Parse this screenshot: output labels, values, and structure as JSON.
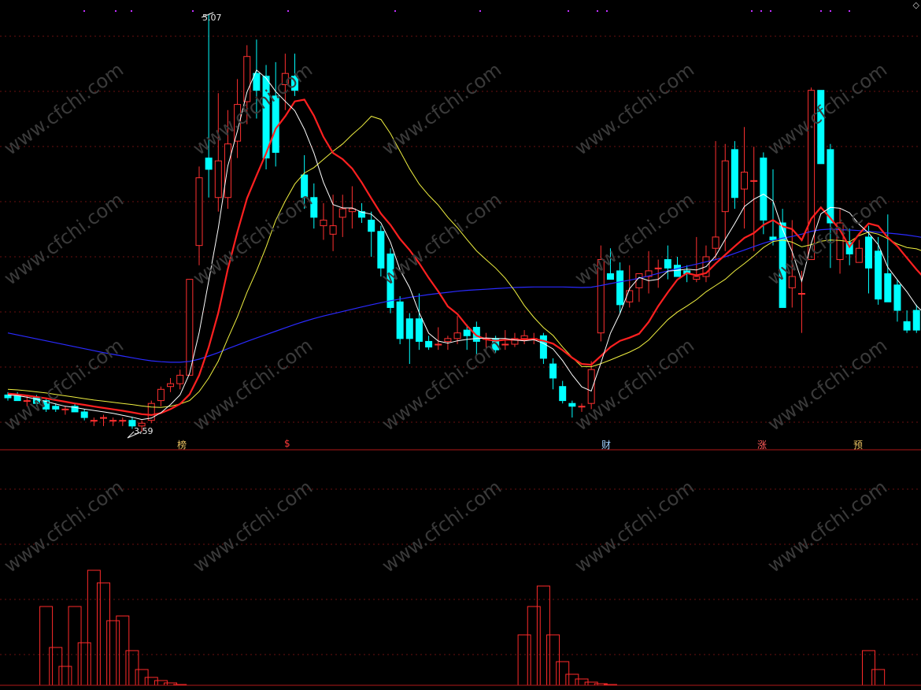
{
  "chart_data": [
    {
      "type": "candlestick",
      "annotations": {
        "high_label": "5.07",
        "low_label": "3.59"
      },
      "event_flags": [
        "榜",
        "$",
        "财",
        "涨",
        "预"
      ],
      "colors": {
        "up": "#ff3030",
        "down": "#00ffff",
        "ma5": "#ffffff",
        "ma10": "#ff2020",
        "ma20": "#f0f040",
        "ma60": "#2a2aff"
      },
      "grid": true,
      "watermark": "www.cfchi.com",
      "corner_mark": "◇",
      "candles": [
        {
          "o": 3.72,
          "h": 3.73,
          "l": 3.7,
          "c": 3.71
        },
        {
          "o": 3.72,
          "h": 3.73,
          "l": 3.7,
          "c": 3.7
        },
        {
          "o": 3.7,
          "h": 3.72,
          "l": 3.68,
          "c": 3.7
        },
        {
          "o": 3.71,
          "h": 3.72,
          "l": 3.68,
          "c": 3.69
        },
        {
          "o": 3.7,
          "h": 3.71,
          "l": 3.66,
          "c": 3.67
        },
        {
          "o": 3.68,
          "h": 3.69,
          "l": 3.66,
          "c": 3.67
        },
        {
          "o": 3.67,
          "h": 3.68,
          "l": 3.65,
          "c": 3.67
        },
        {
          "o": 3.68,
          "h": 3.69,
          "l": 3.66,
          "c": 3.66
        },
        {
          "o": 3.66,
          "h": 3.67,
          "l": 3.63,
          "c": 3.64
        },
        {
          "o": 3.63,
          "h": 3.64,
          "l": 3.61,
          "c": 3.63
        },
        {
          "o": 3.64,
          "h": 3.65,
          "l": 3.61,
          "c": 3.64
        },
        {
          "o": 3.63,
          "h": 3.64,
          "l": 3.61,
          "c": 3.63
        },
        {
          "o": 3.63,
          "h": 3.64,
          "l": 3.61,
          "c": 3.63
        },
        {
          "o": 3.63,
          "h": 3.64,
          "l": 3.6,
          "c": 3.61
        },
        {
          "o": 3.61,
          "h": 3.63,
          "l": 3.59,
          "c": 3.62
        },
        {
          "o": 3.63,
          "h": 3.7,
          "l": 3.62,
          "c": 3.69
        },
        {
          "o": 3.7,
          "h": 3.75,
          "l": 3.68,
          "c": 3.74
        },
        {
          "o": 3.75,
          "h": 3.78,
          "l": 3.73,
          "c": 3.76
        },
        {
          "o": 3.76,
          "h": 3.81,
          "l": 3.74,
          "c": 3.79
        },
        {
          "o": 3.79,
          "h": 4.13,
          "l": 3.79,
          "c": 4.13
        },
        {
          "o": 4.25,
          "h": 4.53,
          "l": 4.18,
          "c": 4.49
        },
        {
          "o": 4.56,
          "h": 5.07,
          "l": 4.42,
          "c": 4.52
        },
        {
          "o": 4.42,
          "h": 4.79,
          "l": 4.37,
          "c": 4.55
        },
        {
          "o": 4.42,
          "h": 4.73,
          "l": 4.38,
          "c": 4.61
        },
        {
          "o": 4.62,
          "h": 4.84,
          "l": 4.56,
          "c": 4.75
        },
        {
          "o": 4.76,
          "h": 4.96,
          "l": 4.68,
          "c": 4.92
        },
        {
          "o": 4.86,
          "h": 4.98,
          "l": 4.7,
          "c": 4.8
        },
        {
          "o": 4.85,
          "h": 4.89,
          "l": 4.52,
          "c": 4.56
        },
        {
          "o": 4.78,
          "h": 4.9,
          "l": 4.53,
          "c": 4.58
        },
        {
          "o": 4.82,
          "h": 4.93,
          "l": 4.73,
          "c": 4.86
        },
        {
          "o": 4.85,
          "h": 4.93,
          "l": 4.78,
          "c": 4.8
        },
        {
          "o": 4.5,
          "h": 4.57,
          "l": 4.38,
          "c": 4.42
        },
        {
          "o": 4.42,
          "h": 4.47,
          "l": 4.31,
          "c": 4.35
        },
        {
          "o": 4.32,
          "h": 4.4,
          "l": 4.27,
          "c": 4.34
        },
        {
          "o": 4.29,
          "h": 4.43,
          "l": 4.23,
          "c": 4.32
        },
        {
          "o": 4.35,
          "h": 4.43,
          "l": 4.28,
          "c": 4.38
        },
        {
          "o": 4.37,
          "h": 4.46,
          "l": 4.31,
          "c": 4.38
        },
        {
          "o": 4.37,
          "h": 4.4,
          "l": 4.33,
          "c": 4.35
        },
        {
          "o": 4.34,
          "h": 4.37,
          "l": 4.21,
          "c": 4.3
        },
        {
          "o": 4.3,
          "h": 4.32,
          "l": 4.14,
          "c": 4.17
        },
        {
          "o": 4.22,
          "h": 4.24,
          "l": 4.01,
          "c": 4.03
        },
        {
          "o": 4.05,
          "h": 4.07,
          "l": 3.9,
          "c": 3.92
        },
        {
          "o": 3.99,
          "h": 4.01,
          "l": 3.83,
          "c": 3.92
        },
        {
          "o": 3.99,
          "h": 4.08,
          "l": 3.88,
          "c": 3.91
        },
        {
          "o": 3.91,
          "h": 3.93,
          "l": 3.88,
          "c": 3.89
        },
        {
          "o": 3.9,
          "h": 3.96,
          "l": 3.88,
          "c": 3.9
        },
        {
          "o": 3.91,
          "h": 3.93,
          "l": 3.88,
          "c": 3.92
        },
        {
          "o": 3.92,
          "h": 4.0,
          "l": 3.9,
          "c": 3.94
        },
        {
          "o": 3.95,
          "h": 3.97,
          "l": 3.88,
          "c": 3.93
        },
        {
          "o": 3.96,
          "h": 3.98,
          "l": 3.86,
          "c": 3.91
        },
        {
          "o": 3.92,
          "h": 3.94,
          "l": 3.88,
          "c": 3.92
        },
        {
          "o": 3.92,
          "h": 3.93,
          "l": 3.87,
          "c": 3.88
        },
        {
          "o": 3.9,
          "h": 3.95,
          "l": 3.88,
          "c": 3.9
        },
        {
          "o": 3.9,
          "h": 3.94,
          "l": 3.89,
          "c": 3.92
        },
        {
          "o": 3.92,
          "h": 3.95,
          "l": 3.9,
          "c": 3.93
        },
        {
          "o": 3.92,
          "h": 3.94,
          "l": 3.9,
          "c": 3.92
        },
        {
          "o": 3.93,
          "h": 3.94,
          "l": 3.83,
          "c": 3.85
        },
        {
          "o": 3.83,
          "h": 3.85,
          "l": 3.74,
          "c": 3.78
        },
        {
          "o": 3.75,
          "h": 3.77,
          "l": 3.69,
          "c": 3.7
        },
        {
          "o": 3.69,
          "h": 3.7,
          "l": 3.64,
          "c": 3.68
        },
        {
          "o": 3.68,
          "h": 3.69,
          "l": 3.66,
          "c": 3.68
        },
        {
          "o": 3.69,
          "h": 3.84,
          "l": 3.67,
          "c": 3.81
        },
        {
          "o": 3.94,
          "h": 4.25,
          "l": 3.91,
          "c": 4.2
        },
        {
          "o": 4.15,
          "h": 4.24,
          "l": 4.14,
          "c": 4.13
        },
        {
          "o": 4.16,
          "h": 4.19,
          "l": 4.01,
          "c": 4.04
        },
        {
          "o": 4.05,
          "h": 4.18,
          "l": 4.03,
          "c": 4.09
        },
        {
          "o": 4.1,
          "h": 4.15,
          "l": 4.05,
          "c": 4.15
        },
        {
          "o": 4.14,
          "h": 4.23,
          "l": 4.08,
          "c": 4.16
        },
        {
          "o": 4.17,
          "h": 4.2,
          "l": 4.1,
          "c": 4.17
        },
        {
          "o": 4.2,
          "h": 4.25,
          "l": 4.13,
          "c": 4.17
        },
        {
          "o": 4.18,
          "h": 4.21,
          "l": 4.14,
          "c": 4.14
        },
        {
          "o": 4.16,
          "h": 4.18,
          "l": 4.12,
          "c": 4.15
        },
        {
          "o": 4.13,
          "h": 4.28,
          "l": 4.12,
          "c": 4.14
        },
        {
          "o": 4.14,
          "h": 4.25,
          "l": 4.12,
          "c": 4.21
        },
        {
          "o": 4.24,
          "h": 4.62,
          "l": 4.2,
          "c": 4.28
        },
        {
          "o": 4.37,
          "h": 4.61,
          "l": 4.23,
          "c": 4.55
        },
        {
          "o": 4.59,
          "h": 4.62,
          "l": 4.38,
          "c": 4.42
        },
        {
          "o": 4.45,
          "h": 4.67,
          "l": 4.31,
          "c": 4.51
        },
        {
          "o": 4.48,
          "h": 4.6,
          "l": 4.23,
          "c": 4.48
        },
        {
          "o": 4.56,
          "h": 4.58,
          "l": 4.29,
          "c": 4.34
        },
        {
          "o": 4.28,
          "h": 4.52,
          "l": 4.25,
          "c": 4.27
        },
        {
          "o": 4.33,
          "h": 4.38,
          "l": 4.04,
          "c": 4.03
        },
        {
          "o": 4.1,
          "h": 4.34,
          "l": 4.03,
          "c": 4.14
        },
        {
          "o": 4.08,
          "h": 4.16,
          "l": 3.94,
          "c": 4.08
        },
        {
          "o": 4.2,
          "h": 4.81,
          "l": 4.2,
          "c": 4.8
        },
        {
          "o": 4.8,
          "h": 4.8,
          "l": 4.54,
          "c": 4.54
        },
        {
          "o": 4.59,
          "h": 4.61,
          "l": 4.17,
          "c": 4.33
        },
        {
          "o": 4.2,
          "h": 4.38,
          "l": 4.15,
          "c": 4.33
        },
        {
          "o": 4.26,
          "h": 4.31,
          "l": 4.18,
          "c": 4.22
        },
        {
          "o": 4.19,
          "h": 4.27,
          "l": 4.19,
          "c": 4.24
        },
        {
          "o": 4.28,
          "h": 4.32,
          "l": 4.08,
          "c": 4.17
        },
        {
          "o": 4.23,
          "h": 4.28,
          "l": 4.04,
          "c": 4.06
        },
        {
          "o": 4.15,
          "h": 4.36,
          "l": 4.08,
          "c": 4.05
        },
        {
          "o": 4.11,
          "h": 4.13,
          "l": 3.98,
          "c": 4.02
        },
        {
          "o": 3.98,
          "h": 4.02,
          "l": 3.94,
          "c": 3.95
        },
        {
          "o": 4.02,
          "h": 4.04,
          "l": 3.94,
          "c": 3.95
        },
        {
          "o": 3.95,
          "h": 4.02,
          "l": 3.93,
          "c": 3.99
        },
        {
          "o": 3.96,
          "h": 4.04,
          "l": 3.92,
          "c": 4.0
        }
      ],
      "ma5": [
        3.72,
        3.718,
        3.712,
        3.705,
        3.697,
        3.688,
        3.68,
        3.676,
        3.67,
        3.665,
        3.66,
        3.655,
        3.648,
        3.641,
        3.633,
        3.638,
        3.657,
        3.686,
        3.72,
        3.796,
        3.941,
        4.124,
        4.311,
        4.532,
        4.656,
        4.794,
        4.872,
        4.843,
        4.796,
        4.761,
        4.728,
        4.662,
        4.578,
        4.474,
        4.395,
        4.383,
        4.383,
        4.368,
        4.361,
        4.33,
        4.262,
        4.163,
        4.101,
        4.012,
        3.939,
        3.911,
        3.904,
        3.912,
        3.917,
        3.92,
        3.922,
        3.92,
        3.92,
        3.915,
        3.912,
        3.916,
        3.903,
        3.883,
        3.842,
        3.791,
        3.749,
        3.734,
        3.833,
        3.939,
        4.009,
        4.097,
        4.137,
        4.125,
        4.13,
        4.159,
        4.162,
        4.166,
        4.163,
        4.175,
        4.213,
        4.272,
        4.328,
        4.388,
        4.414,
        4.432,
        4.408,
        4.308,
        4.228,
        4.123,
        4.258,
        4.362,
        4.385,
        4.382,
        4.366,
        4.325,
        4.294,
        4.253,
        4.173,
        4.128,
        4.086,
        4.036,
        4.004,
        4.006
      ],
      "ma10": [
        3.725,
        3.722,
        3.718,
        3.713,
        3.708,
        3.702,
        3.696,
        3.69,
        3.685,
        3.679,
        3.674,
        3.669,
        3.664,
        3.658,
        3.652,
        3.649,
        3.656,
        3.67,
        3.688,
        3.722,
        3.79,
        3.889,
        4.011,
        4.166,
        4.298,
        4.417,
        4.498,
        4.577,
        4.664,
        4.708,
        4.761,
        4.767,
        4.71,
        4.635,
        4.578,
        4.556,
        4.523,
        4.473,
        4.417,
        4.363,
        4.323,
        4.273,
        4.234,
        4.187,
        4.135,
        4.087,
        4.034,
        4.007,
        3.965,
        3.93,
        3.917,
        3.912,
        3.916,
        3.916,
        3.916,
        3.919,
        3.912,
        3.902,
        3.879,
        3.852,
        3.83,
        3.827,
        3.858,
        3.89,
        3.912,
        3.923,
        3.937,
        3.979,
        4.035,
        4.084,
        4.129,
        4.152,
        4.144,
        4.152,
        4.186,
        4.217,
        4.247,
        4.277,
        4.294,
        4.323,
        4.34,
        4.318,
        4.308,
        4.269,
        4.345,
        4.385,
        4.347,
        4.305,
        4.245,
        4.291,
        4.328,
        4.319,
        4.278,
        4.247,
        4.206,
        4.165,
        4.128,
        4.09
      ],
      "ma20": [
        3.74,
        3.738,
        3.735,
        3.731,
        3.727,
        3.722,
        3.717,
        3.712,
        3.707,
        3.702,
        3.698,
        3.694,
        3.69,
        3.686,
        3.681,
        3.677,
        3.676,
        3.68,
        3.688,
        3.7,
        3.732,
        3.78,
        3.84,
        3.92,
        3.997,
        4.084,
        4.16,
        4.245,
        4.339,
        4.408,
        4.468,
        4.507,
        4.526,
        4.555,
        4.584,
        4.61,
        4.643,
        4.673,
        4.708,
        4.697,
        4.647,
        4.584,
        4.522,
        4.468,
        4.428,
        4.393,
        4.35,
        4.313,
        4.271,
        4.231,
        4.2,
        4.17,
        4.134,
        4.089,
        4.037,
        3.995,
        3.959,
        3.931,
        3.89,
        3.853,
        3.821,
        3.82,
        3.831,
        3.844,
        3.858,
        3.872,
        3.889,
        3.915,
        3.951,
        3.987,
        4.014,
        4.035,
        4.058,
        4.086,
        4.108,
        4.13,
        4.16,
        4.186,
        4.213,
        4.243,
        4.264,
        4.269,
        4.262,
        4.245,
        4.253,
        4.265,
        4.269,
        4.268,
        4.263,
        4.285,
        4.298,
        4.29,
        4.274,
        4.255,
        4.243,
        4.238,
        4.226,
        4.209
      ],
      "ma60": [
        3.94,
        3.933,
        3.926,
        3.919,
        3.912,
        3.905,
        3.898,
        3.891,
        3.884,
        3.877,
        3.87,
        3.864,
        3.858,
        3.852,
        3.846,
        3.841,
        3.838,
        3.836,
        3.836,
        3.839,
        3.847,
        3.858,
        3.87,
        3.884,
        3.897,
        3.91,
        3.922,
        3.934,
        3.946,
        3.958,
        3.97,
        3.981,
        3.991,
        4.0,
        4.008,
        4.016,
        4.024,
        4.032,
        4.04,
        4.047,
        4.054,
        4.06,
        4.066,
        4.071,
        4.076,
        4.08,
        4.084,
        4.088,
        4.091,
        4.093,
        4.095,
        4.097,
        4.099,
        4.101,
        4.102,
        4.103,
        4.103,
        4.103,
        4.103,
        4.102,
        4.101,
        4.102,
        4.108,
        4.115,
        4.121,
        4.127,
        4.134,
        4.142,
        4.151,
        4.16,
        4.168,
        4.176,
        4.184,
        4.192,
        4.2,
        4.21,
        4.222,
        4.234,
        4.246,
        4.258,
        4.268,
        4.276,
        4.282,
        4.29,
        4.3,
        4.306,
        4.308,
        4.306,
        4.305,
        4.303,
        4.3,
        4.297,
        4.294,
        4.291,
        4.287,
        4.282,
        4.276,
        4.27
      ]
    },
    {
      "type": "bar",
      "grid": true,
      "values": [
        0,
        0,
        0,
        0,
        0,
        0,
        0,
        0,
        0,
        0,
        0,
        0,
        0,
        0,
        0,
        0,
        0,
        0,
        0,
        0,
        0,
        0,
        0,
        0,
        0,
        0,
        0,
        0,
        0,
        0,
        0,
        0,
        0,
        0,
        0,
        0,
        0,
        0,
        0,
        0,
        0,
        0,
        0,
        0,
        0,
        0,
        0,
        0,
        0,
        0,
        0,
        0,
        0,
        0,
        0,
        0,
        0,
        0,
        0,
        0,
        0,
        0,
        0,
        0,
        0,
        0,
        0,
        0,
        0,
        0,
        0,
        0,
        0,
        0,
        0,
        0,
        0,
        0,
        0,
        0,
        0,
        0,
        0,
        0,
        0,
        0,
        0,
        0,
        0,
        0,
        0,
        0,
        0,
        0,
        0,
        0,
        0,
        0
      ],
      "bars": [
        {
          "i": 4,
          "v": 100
        },
        {
          "i": 5,
          "v": 48
        },
        {
          "i": 6,
          "v": 24
        },
        {
          "i": 7,
          "v": 100
        },
        {
          "i": 8,
          "v": 54
        },
        {
          "i": 9,
          "v": 146
        },
        {
          "i": 10,
          "v": 130
        },
        {
          "i": 11,
          "v": 82
        },
        {
          "i": 12,
          "v": 88
        },
        {
          "i": 13,
          "v": 44
        },
        {
          "i": 14,
          "v": 20
        },
        {
          "i": 15,
          "v": 10
        },
        {
          "i": 16,
          "v": 6
        },
        {
          "i": 17,
          "v": 3
        },
        {
          "i": 18,
          "v": 1
        },
        {
          "i": 54,
          "v": 64
        },
        {
          "i": 55,
          "v": 100
        },
        {
          "i": 56,
          "v": 126
        },
        {
          "i": 57,
          "v": 64
        },
        {
          "i": 58,
          "v": 30
        },
        {
          "i": 59,
          "v": 14
        },
        {
          "i": 60,
          "v": 8
        },
        {
          "i": 61,
          "v": 4
        },
        {
          "i": 62,
          "v": 2
        },
        {
          "i": 63,
          "v": 1
        },
        {
          "i": 90,
          "v": 44
        },
        {
          "i": 91,
          "v": 20
        }
      ]
    }
  ]
}
